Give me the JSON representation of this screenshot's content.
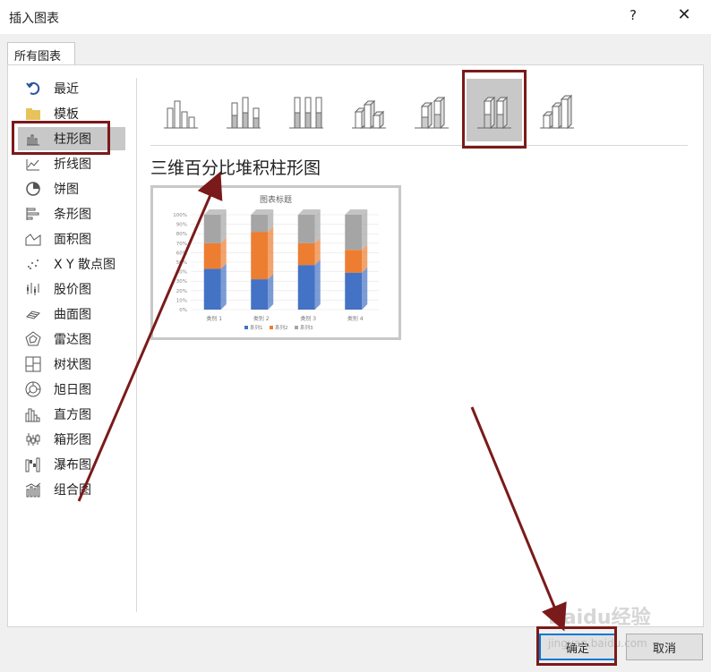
{
  "window": {
    "title": "插入图表",
    "help": "?",
    "close": "✕"
  },
  "tab": {
    "label": "所有图表"
  },
  "categories": [
    {
      "label": "最近",
      "icon": "recent-icon"
    },
    {
      "label": "模板",
      "icon": "folder-icon"
    },
    {
      "label": "柱形图",
      "icon": "column-chart-icon",
      "selected": true
    },
    {
      "label": "折线图",
      "icon": "line-chart-icon"
    },
    {
      "label": "饼图",
      "icon": "pie-chart-icon"
    },
    {
      "label": "条形图",
      "icon": "bar-chart-icon"
    },
    {
      "label": "面积图",
      "icon": "area-chart-icon"
    },
    {
      "label": "X Y 散点图",
      "icon": "scatter-chart-icon"
    },
    {
      "label": "股价图",
      "icon": "stock-chart-icon"
    },
    {
      "label": "曲面图",
      "icon": "surface-chart-icon"
    },
    {
      "label": "雷达图",
      "icon": "radar-chart-icon"
    },
    {
      "label": "树状图",
      "icon": "treemap-chart-icon"
    },
    {
      "label": "旭日图",
      "icon": "sunburst-chart-icon"
    },
    {
      "label": "直方图",
      "icon": "histogram-chart-icon"
    },
    {
      "label": "箱形图",
      "icon": "box-whisker-chart-icon"
    },
    {
      "label": "瀑布图",
      "icon": "waterfall-chart-icon"
    },
    {
      "label": "组合图",
      "icon": "combo-chart-icon"
    }
  ],
  "subtypes": [
    {
      "icon": "clustered-column-icon"
    },
    {
      "icon": "stacked-column-icon"
    },
    {
      "icon": "percent-stacked-column-icon"
    },
    {
      "icon": "3d-clustered-column-icon"
    },
    {
      "icon": "3d-stacked-column-icon"
    },
    {
      "icon": "3d-percent-stacked-column-icon",
      "selected": true
    },
    {
      "icon": "3d-column-icon"
    }
  ],
  "selected_chart_name": "三维百分比堆积柱形图",
  "chart_data": {
    "type": "bar",
    "stacked": "percent",
    "title": "图表标题",
    "categories": [
      "类别 1",
      "类别 2",
      "类别 3",
      "类别 4"
    ],
    "series": [
      {
        "name": "系列1",
        "values": [
          43,
          32,
          47,
          39
        ],
        "color": "#4472c4"
      },
      {
        "name": "系列2",
        "values": [
          27,
          50,
          23,
          24
        ],
        "color": "#ed7d31"
      },
      {
        "name": "系列3",
        "values": [
          30,
          18,
          30,
          37
        ],
        "color": "#a5a5a5"
      }
    ],
    "yticks": [
      "100%",
      "90%",
      "80%",
      "70%",
      "60%",
      "50%",
      "40%",
      "30%",
      "20%",
      "10%",
      "0%"
    ],
    "ylim": [
      0,
      100
    ],
    "legend": "bottom"
  },
  "buttons": {
    "ok": "确定",
    "cancel": "取消"
  },
  "watermark": {
    "brand": "Baidu经验",
    "url": "jingyan.baidu.com"
  },
  "colors": {
    "highlight": "#7b1a1a",
    "selected_bg": "#c8c8c8",
    "ok_border": "#0078d7"
  }
}
